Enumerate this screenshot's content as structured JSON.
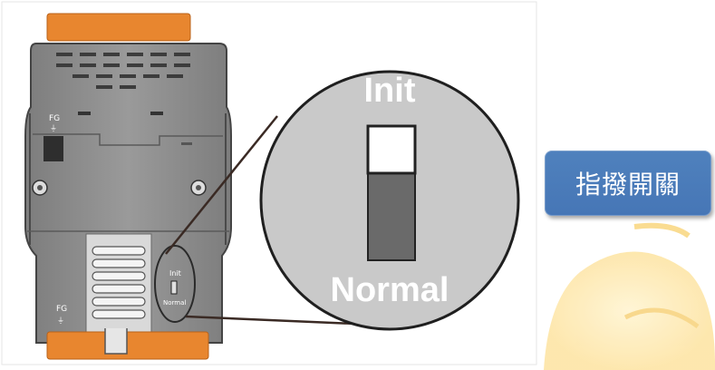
{
  "diagram": {
    "fg_label_top": "FG",
    "fg_label_bottom": "FG",
    "switch_label_small_init": "Init",
    "switch_label_small_normal": "Normal",
    "zoom_label_init": "Init",
    "zoom_label_normal": "Normal"
  },
  "callout": {
    "label": "指撥開關"
  },
  "colors": {
    "terminal_orange": "#e8862f",
    "device_body": "#8f8f8f",
    "zoom_circle": "#c9c9c9",
    "callout_blue": "#4a7ab9",
    "watermark_yellow": "#fde7a8"
  }
}
